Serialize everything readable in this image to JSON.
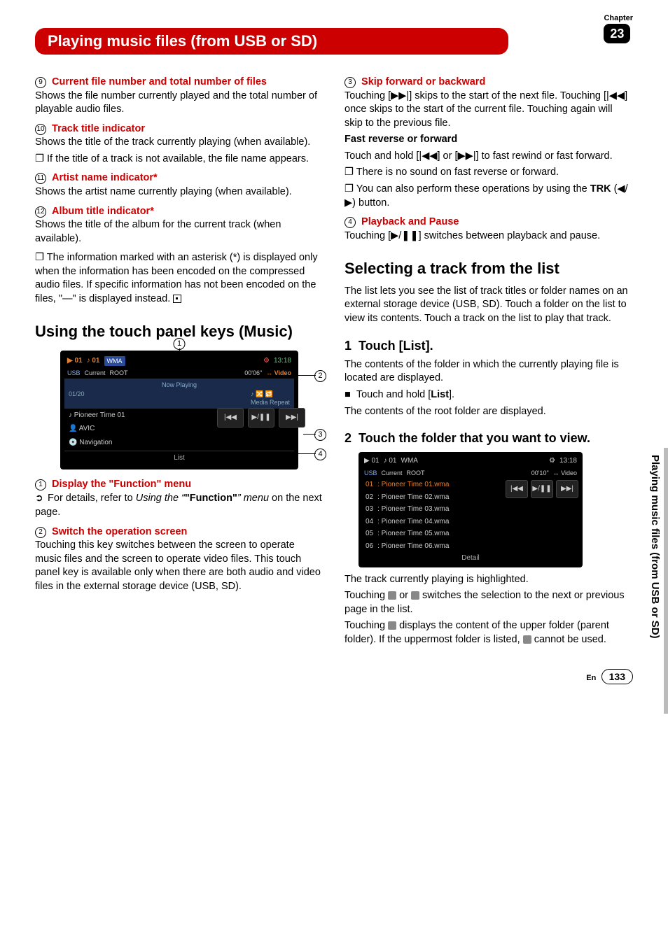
{
  "chapter": {
    "label": "Chapter",
    "number": "23"
  },
  "title": "Playing music files (from USB or SD)",
  "side_text": "Playing music files (from USB or SD)",
  "footer": {
    "lang": "En",
    "page": "133"
  },
  "left": {
    "i9_h": "Current file number and total number of files",
    "i9_p": "Shows the file number currently played and the total number of playable audio files.",
    "i10_h": "Track title indicator",
    "i10_p": "Shows the title of the track currently playing (when available).",
    "i10_b": "If the title of a track is not available, the file name appears.",
    "i11_h": "Artist name indicator*",
    "i11_p": "Shows the artist name currently playing (when available).",
    "i12_h": "Album title indicator*",
    "i12_p": "Shows the title of the album for the current track (when available).",
    "astnote": "The information marked with an asterisk (*) is displayed only when the information has been encoded on the compressed audio files. If specific information has not been encoded on the files, \"—\" is displayed instead.",
    "h2": "Using the touch panel keys (Music)",
    "b1_h": "Display the \"Function\" menu",
    "b1_hand": "➲",
    "b1_p1": "For details, refer to ",
    "b1_it1": "Using the ",
    "b1_q": "\"Function\"",
    "b1_it2": " menu",
    "b1_p2": " on the next page.",
    "b2_h": "Switch the operation screen",
    "b2_p": "Touching this key switches between the screen to operate music files and the screen to operate video files. This touch panel key is available only when there are both audio and video files in the external storage device (USB, SD)."
  },
  "right": {
    "b3_h": "Skip forward or backward",
    "b3_p1a": "Touching [",
    "b3_sym_next": "▶▶|",
    "b3_p1b": "] skips to the start of the next file. Touching [",
    "b3_sym_prev": "|◀◀",
    "b3_p1c": "] once skips to the start of the current file. Touching again will skip to the previous file.",
    "b3_fast_h": "Fast reverse or forward",
    "b3_fast_p_a": "Touch and hold [",
    "b3_fast_p_b": "] or [",
    "b3_fast_p_c": "] to fast rewind or fast forward.",
    "b3_bul1": "There is no sound on fast reverse or forward.",
    "b3_bul2a": "You can also perform these operations by using the ",
    "b3_trk": "TRK",
    "b3_bul2b": " (◀/▶) button.",
    "b4_h": "Playback and Pause",
    "b4_p_a": "Touching [",
    "b4_sym": "▶/❚❚",
    "b4_p_b": "] switches between playback and pause.",
    "h2": "Selecting a track from the list",
    "sel_p": "The list lets you see the list of track titles or folder names on an external storage device (USB, SD). Touch a folder on the list to view its contents. Touch a track on the list to play that track.",
    "s1_h": "Touch [List].",
    "s1_p": "The contents of the folder in which the currently playing file is located are displayed.",
    "s1_bul_a": "Touch and hold [",
    "s1_list": "List",
    "s1_bul_b": "].",
    "s1_p2": "The contents of the root folder are displayed.",
    "s2_h": "Touch the folder that you want to view.",
    "after_p1": "The track currently playing is highlighted.",
    "after_p2a": "Touching ",
    "after_p2b": " or ",
    "after_p2c": " switches the selection to the next or previous page in the list.",
    "after_p3a": "Touching ",
    "after_p3b": " displays the content of the upper folder (parent folder). If the uppermost folder is listed, ",
    "after_p3c": " cannot be used."
  },
  "fig1": {
    "callouts": [
      "1",
      "2",
      "3",
      "4"
    ],
    "folder": "01",
    "track": "01",
    "fmt": "WMA",
    "time_total": "13:18",
    "time": "00'06\"",
    "video": "↔ Video",
    "usb": "USB",
    "current": "Current",
    "root": "ROOT",
    "nowplaying": "Now Playing",
    "idx": "01/20",
    "repeat": "Media Repeat",
    "row1": "Pioneer Time 01",
    "row2": "AVIC",
    "row3": "Navigation",
    "list": "List",
    "ctl_prev": "|◀◀",
    "ctl_play": "▶/❚❚",
    "ctl_next": "▶▶|"
  },
  "fig2": {
    "folder": "01",
    "track": "01",
    "fmt": "WMA",
    "time_total": "13:18",
    "time": "00'10\"",
    "video": "↔ Video",
    "usb": "USB",
    "current": "Current",
    "root": "ROOT",
    "rows": [
      {
        "n": "01",
        "t": ": Pioneer Time 01.wma",
        "hi": true
      },
      {
        "n": "02",
        "t": ": Pioneer Time 02.wma"
      },
      {
        "n": "03",
        "t": ": Pioneer Time 03.wma"
      },
      {
        "n": "04",
        "t": ": Pioneer Time 04.wma"
      },
      {
        "n": "05",
        "t": ": Pioneer Time 05.wma"
      },
      {
        "n": "06",
        "t": ": Pioneer Time 06.wma"
      }
    ],
    "detail": "Detail",
    "ctl_prev": "|◀◀",
    "ctl_play": "▶/❚❚",
    "ctl_next": "▶▶|"
  }
}
